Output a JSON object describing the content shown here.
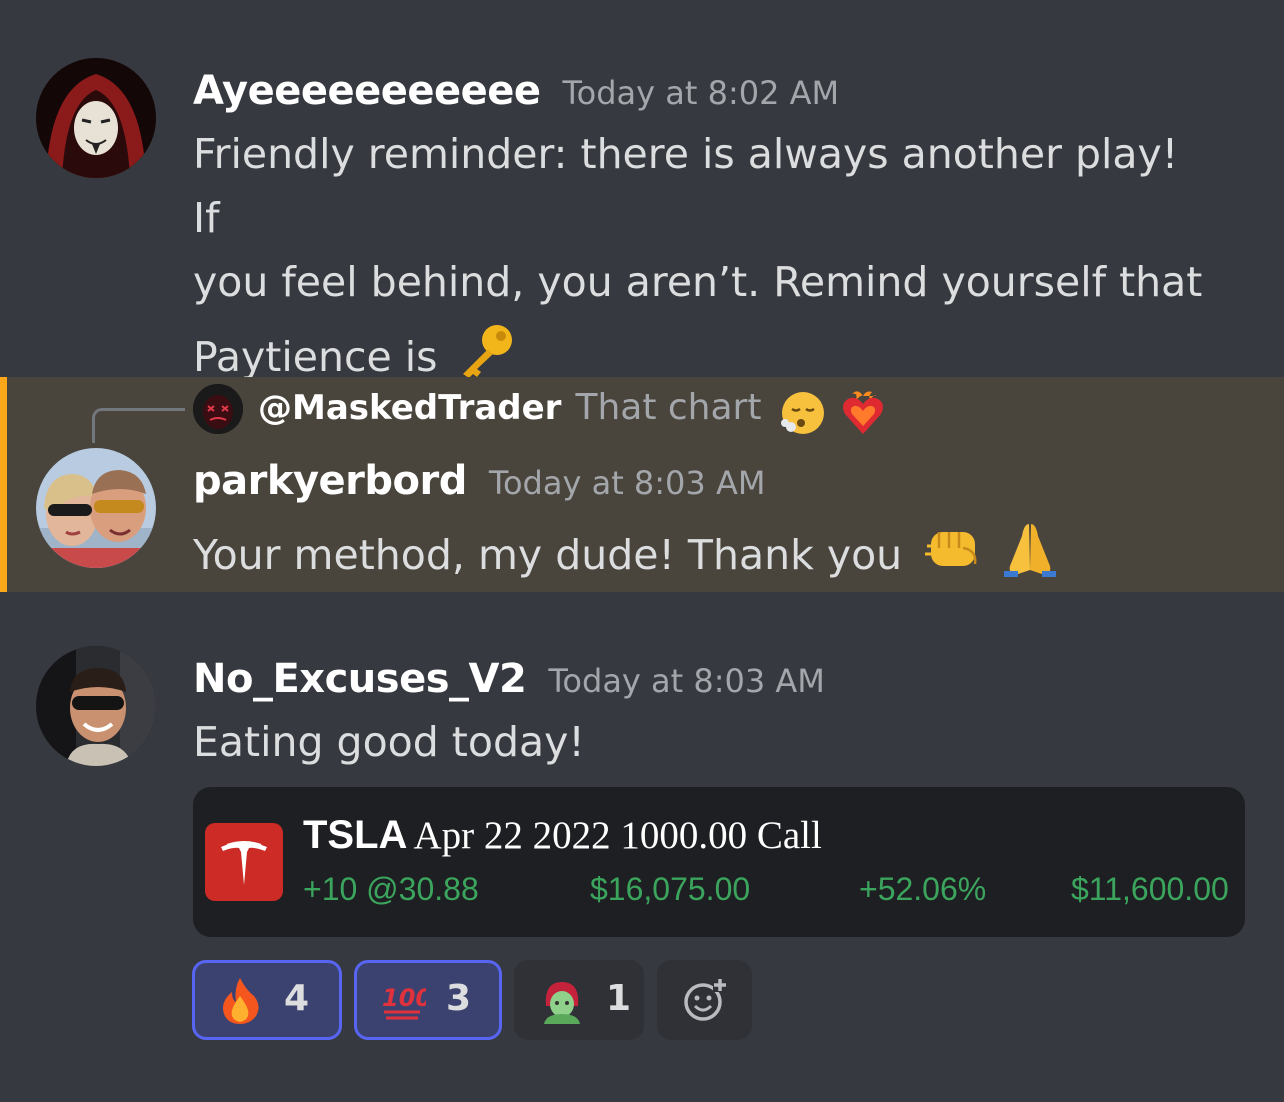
{
  "messages": [
    {
      "username": "Ayeeeeeeeeeee",
      "timestamp": "Today at 8:02 AM",
      "lines": [
        "Friendly reminder: there is always another play! If",
        "you feel behind, you aren’t. Remind yourself that",
        "Paytience is"
      ],
      "trailing_emoji": "key-emoji"
    },
    {
      "reply_to": {
        "user": "@MaskedTrader",
        "text": "That chart",
        "emojis": [
          "face-exhaling-emoji",
          "heart-on-fire-emoji"
        ]
      },
      "username": "parkyerbord",
      "timestamp": "Today at 8:03 AM",
      "text": "Your method, my dude! Thank you",
      "trailing_emojis": [
        "oncoming-fist-emoji",
        "folded-hands-emoji"
      ],
      "highlight_color": "#faa81a"
    },
    {
      "username": "No_Excuses_V2",
      "timestamp": "Today at 8:03 AM",
      "text": "Eating good today!",
      "embed": {
        "ticker": "TSLA",
        "description": "Apr 22 2022 1000.00 Call",
        "position": "+10 @30.88",
        "market_value": "$16,075.00",
        "percent_change": "+52.06%",
        "profit": "$11,600.00",
        "stat_color": "#3ba55d"
      },
      "reactions": [
        {
          "emoji": "fire-emoji",
          "count": "4",
          "active": true
        },
        {
          "emoji": "hundred-points-emoji",
          "count": "3",
          "active": true
        },
        {
          "emoji": "zombie-woman-emoji",
          "count": "1",
          "active": false
        },
        {
          "emoji": "add-reaction-icon",
          "count": "",
          "active": false
        }
      ]
    }
  ],
  "colors": {
    "background": "#36393f",
    "accent": "#5865f2",
    "mention_highlight": "#faa81a"
  }
}
